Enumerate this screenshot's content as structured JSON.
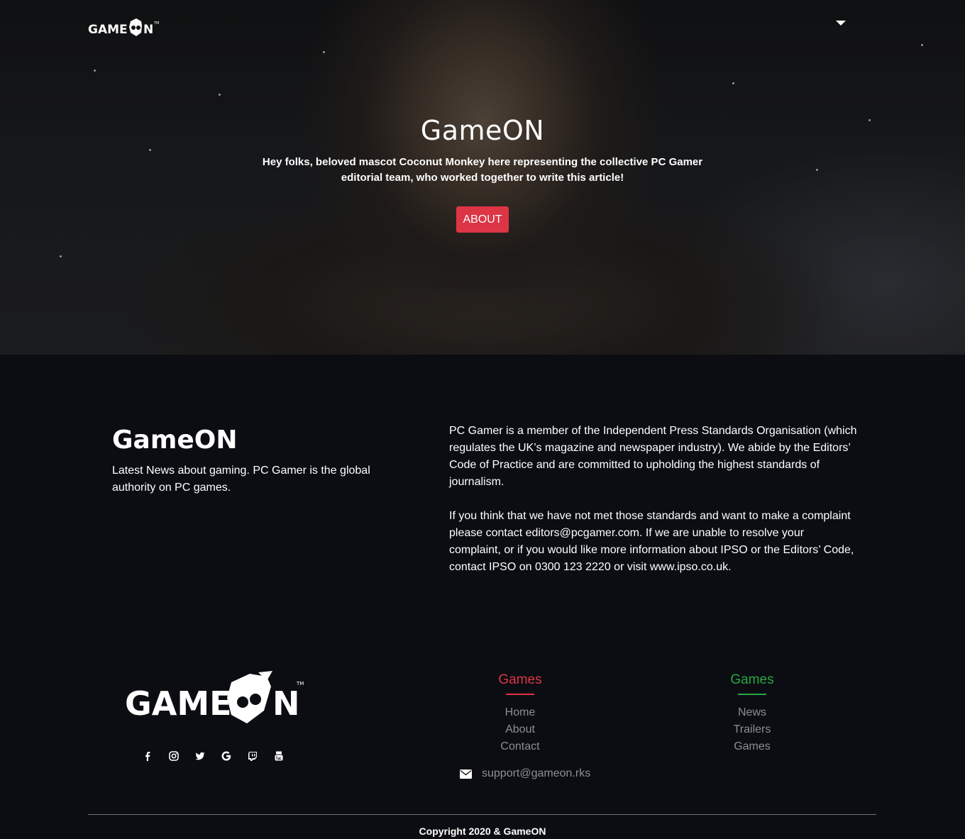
{
  "header": {
    "logo_text": "GAME",
    "logo_tail": "N",
    "logo_tm": "TM",
    "menu_icon": "caret-down-icon"
  },
  "hero": {
    "title": "GameON",
    "text": "Hey folks, beloved mascot Coconut Monkey here representing the collective PC Gamer editorial team, who worked together to write this article!",
    "button_label": "ABOUT"
  },
  "info": {
    "title": "GameON",
    "subtitle": "Latest News about gaming. PC Gamer is the global authority on PC games.",
    "paragraph_1": "PC Gamer is a member of the Independent Press Standards Organisation (which regulates the UK’s magazine and newspaper industry). We abide by the Editors’ Code of Practice and are committed to upholding the highest standards of journalism.",
    "paragraph_2": "If you think that we have not met those standards and want to make a complaint please contact editors@pcgamer.com. If we are unable to resolve your complaint, or if you would like more information about IPSO or the Editors’ Code, contact IPSO on 0300 123 2220 or visit www.ipso.co.uk."
  },
  "footer": {
    "socials": [
      "facebook-icon",
      "instagram-icon",
      "twitter-icon",
      "google-icon",
      "twitch-icon",
      "youtube-icon"
    ],
    "col1": {
      "title": "Games",
      "links": [
        "Home",
        "About",
        "Contact"
      ]
    },
    "col2": {
      "title": "Games",
      "links": [
        "News",
        "Trailers",
        "Games"
      ]
    },
    "support_email": "support@gameon.rks",
    "copyright": "Copyright 2020 & GameON"
  },
  "colors": {
    "accent_red": "#dc3545",
    "accent_green": "#28a745",
    "background": "#0b0d12"
  }
}
